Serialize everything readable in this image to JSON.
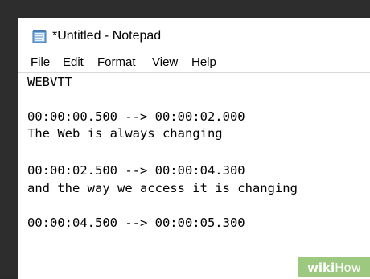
{
  "window": {
    "title": "*Untitled - Notepad",
    "app_icon": "notepad-icon"
  },
  "menu": [
    {
      "label": "File"
    },
    {
      "label": "Edit"
    },
    {
      "label": "Format"
    },
    {
      "label": "View"
    },
    {
      "label": "Help"
    }
  ],
  "editor": {
    "lines": [
      "WEBVTT",
      "",
      "00:00:00.500 --> 00:00:02.000",
      "The Web is always changing",
      "",
      "00:00:02.500 --> 00:00:04.300",
      "and the way we access it is changing",
      "",
      "00:00:04.500 --> 00:00:05.300"
    ]
  },
  "watermark": {
    "wiki": "wiki",
    "how": "How"
  }
}
